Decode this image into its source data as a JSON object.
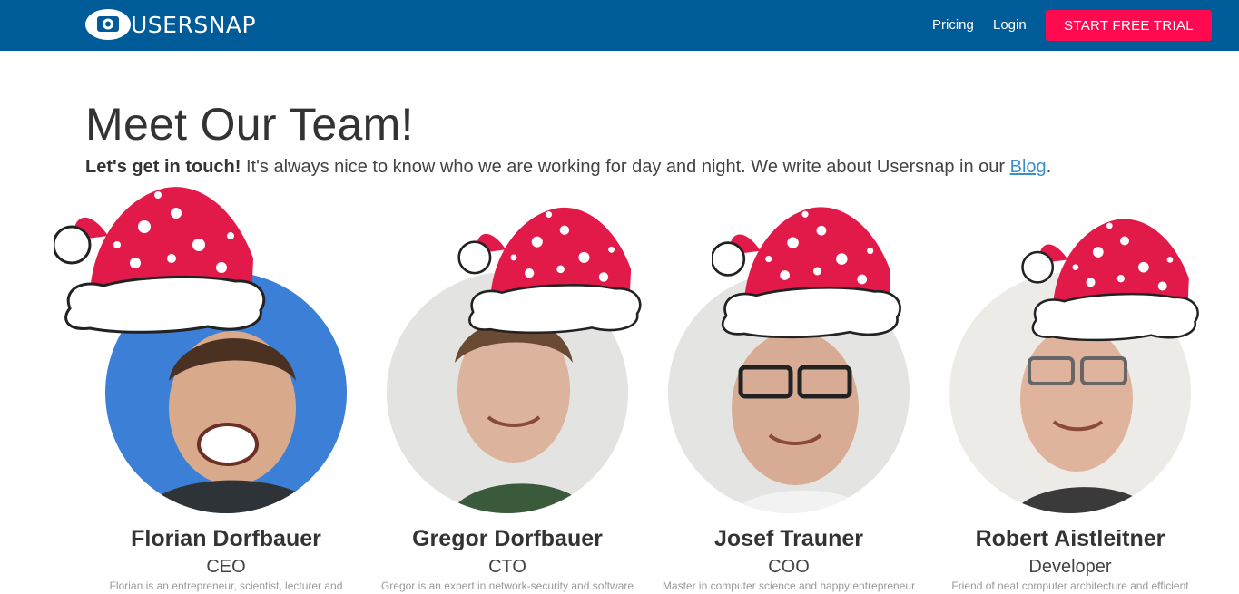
{
  "header": {
    "brand": "USERSNAP",
    "nav": {
      "pricing": "Pricing",
      "login": "Login"
    },
    "cta": "START FREE TRIAL",
    "colors": {
      "bar": "#005b99",
      "cta": "#ff0a51"
    }
  },
  "main": {
    "title": "Meet Our Team!",
    "intro": {
      "lead": "Let's get in touch!",
      "text": " It's always nice to know who we are working for day and night. We write about Usersnap in our ",
      "link": "Blog",
      "end": "."
    },
    "team": [
      {
        "name": "Florian Dorfbauer",
        "role": "CEO",
        "bio": "Florian is an entrepreneur, scientist, lecturer and"
      },
      {
        "name": "Gregor Dorfbauer",
        "role": "CTO",
        "bio": "Gregor is an expert in network-security and software"
      },
      {
        "name": "Josef Trauner",
        "role": "COO",
        "bio": "Master in computer science and happy entrepreneur"
      },
      {
        "name": "Robert Aistleitner",
        "role": "Developer",
        "bio": "Friend of neat computer architecture and efficient"
      }
    ],
    "hat_icon": "santa-hat-icon",
    "avatar_icon": "person-photo-icon"
  }
}
